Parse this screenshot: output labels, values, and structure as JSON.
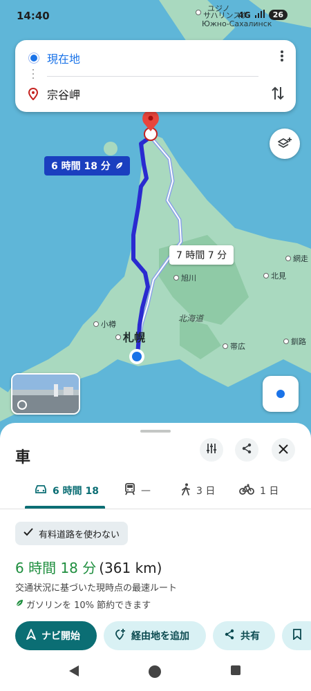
{
  "status_bar": {
    "time": "14:40",
    "network": "4G",
    "battery": "26"
  },
  "route_card": {
    "origin": "現在地",
    "destination": "宗谷岬"
  },
  "map": {
    "labels": {
      "sakhalin_city": "ユジノ",
      "sakhalin_city2": "サハリンスク",
      "sakhalin_city_ru": "Южно-Сахалинск",
      "abashiri": "網走",
      "kitami": "北見",
      "asahikawa": "旭川",
      "hokkaido": "北海道",
      "otaru": "小樽",
      "sapporo": "札幌",
      "obihiro": "帯広",
      "kushiro": "釧路"
    },
    "route_main_label": "6 時間 18 分",
    "route_alt_label": "7 時間 7 分",
    "colors": {
      "sea": "#5fb6d8",
      "land": "#a9d9bf",
      "land_dark": "#8fcaa6",
      "route": "#2a2ad0",
      "route_alt": "#8aa2e8"
    }
  },
  "sheet": {
    "title": "車",
    "tabs": [
      {
        "label": "6 時間 18",
        "icon": "car-icon"
      },
      {
        "label": "—",
        "icon": "train-icon"
      },
      {
        "label": "3 日",
        "icon": "walk-icon"
      },
      {
        "label": "1 日",
        "icon": "bike-icon"
      }
    ],
    "toll_chip": "有料道路を使わない",
    "duration": "6 時間 18 分",
    "distance": "(361 km)",
    "description": "交通状況に基づいた現時点の最速ルート",
    "eco": "ガソリンを 10% 節約できます",
    "actions": {
      "navigate": "ナビ開始",
      "add_stop": "経由地を追加",
      "share": "共有"
    }
  }
}
